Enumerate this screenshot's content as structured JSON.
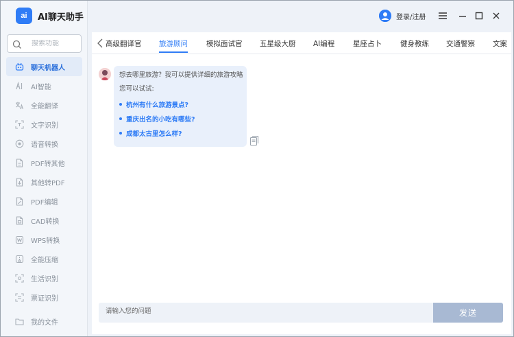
{
  "app": {
    "logo_text": "ai",
    "title": "AI聊天助手"
  },
  "search": {
    "placeholder": "搜索功能"
  },
  "sidebar": {
    "items": [
      {
        "label": "聊天机器人",
        "icon": "robot-icon",
        "active": true
      },
      {
        "label": "AI智能",
        "icon": "ai-icon"
      },
      {
        "label": "全能翻译",
        "icon": "translate-icon"
      },
      {
        "label": "文字识别",
        "icon": "ocr-icon"
      },
      {
        "label": "语音转换",
        "icon": "voice-icon"
      },
      {
        "label": "PDF转其他",
        "icon": "pdf-icon"
      },
      {
        "label": "其他转PDF",
        "icon": "to-pdf-icon"
      },
      {
        "label": "PDF编辑",
        "icon": "pdf-edit-icon"
      },
      {
        "label": "CAD转换",
        "icon": "cad-icon"
      },
      {
        "label": "WPS转换",
        "icon": "wps-icon"
      },
      {
        "label": "全能压缩",
        "icon": "compress-icon"
      },
      {
        "label": "生活识别",
        "icon": "scan-icon"
      },
      {
        "label": "票证识别",
        "icon": "ticket-icon"
      }
    ],
    "my_files": "我的文件"
  },
  "header": {
    "login_label": "登录/注册"
  },
  "tabs": [
    "高级翻译官",
    "旅游顾问",
    "模拟面试官",
    "五星级大厨",
    "AI编程",
    "星座占卜",
    "健身教练",
    "交通警察",
    "文案"
  ],
  "active_tab": "旅游顾问",
  "message": {
    "intro": "想去哪里旅游？我可以提供详细的旅游攻略",
    "try_label": "您可以试试:",
    "suggestions": [
      "杭州有什么旅游景点?",
      "重庆出名的小吃有哪些?",
      "成都太古里怎么样?"
    ]
  },
  "composer": {
    "placeholder": "请输入您的问题",
    "send_label": "发送"
  },
  "colors": {
    "accent": "#2f7cf6",
    "send_button": "#a8b9d3",
    "bubble": "#e9f0fb"
  }
}
